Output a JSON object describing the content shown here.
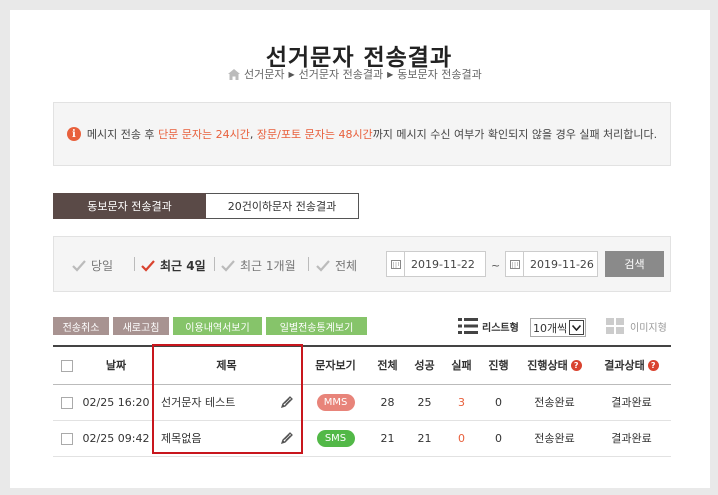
{
  "page": {
    "title": "선거문자 전송결과",
    "breadcrumb": [
      "선거문자",
      "선거문자 전송결과",
      "동보문자 전송결과"
    ]
  },
  "notice": {
    "prefix": "메시지 전송 후 ",
    "hl1": "단문 문자는 24시간",
    "mid": ", ",
    "hl2": "장문/포토 문자는 48시간",
    "suffix": "까지 메시지 수신 여부가 확인되지 않을 경우 실패 처리합니다."
  },
  "tabs": [
    {
      "label": "동보문자 전송결과",
      "active": true
    },
    {
      "label": "20건이하문자 전송결과",
      "active": false
    }
  ],
  "filter": {
    "periods": [
      {
        "label": "당일",
        "selected": false
      },
      {
        "label": "최근 4일",
        "selected": true
      },
      {
        "label": "최근 1개월",
        "selected": false
      },
      {
        "label": "전체",
        "selected": false
      }
    ],
    "date_from": "2019-11-22",
    "tilde": "~",
    "date_to": "2019-11-26",
    "search_label": "검색"
  },
  "actions": {
    "cancel": "전송취소",
    "refresh": "새로고침",
    "history": "이용내역서보기",
    "daily_stats": "일별전송통계보기"
  },
  "view": {
    "list_label": "리스트형",
    "page_size": "10개씩",
    "image_label": "이미지형"
  },
  "table": {
    "headers": {
      "date": "날짜",
      "subject": "제목",
      "view": "문자보기",
      "total": "전체",
      "success": "성공",
      "fail": "실패",
      "progress": "진행",
      "progress_status": "진행상태",
      "result_status": "결과상태"
    },
    "rows": [
      {
        "date": "02/25 16:20",
        "subject": "선거문자 테스트",
        "type": "MMS",
        "total": "28",
        "success": "25",
        "fail": "3",
        "progress": "0",
        "progress_status": "전송완료",
        "result_status": "결과완료"
      },
      {
        "date": "02/25 09:42",
        "subject": "제목없음",
        "type": "SMS",
        "total": "21",
        "success": "21",
        "fail": "0",
        "progress": "0",
        "progress_status": "전송완료",
        "result_status": "결과완료"
      }
    ]
  },
  "colors": {
    "accent": "#e8603c",
    "tab_active": "#5a4a47",
    "mms": "#e8847a",
    "sms": "#52b847",
    "highlight": "#c8161d"
  }
}
